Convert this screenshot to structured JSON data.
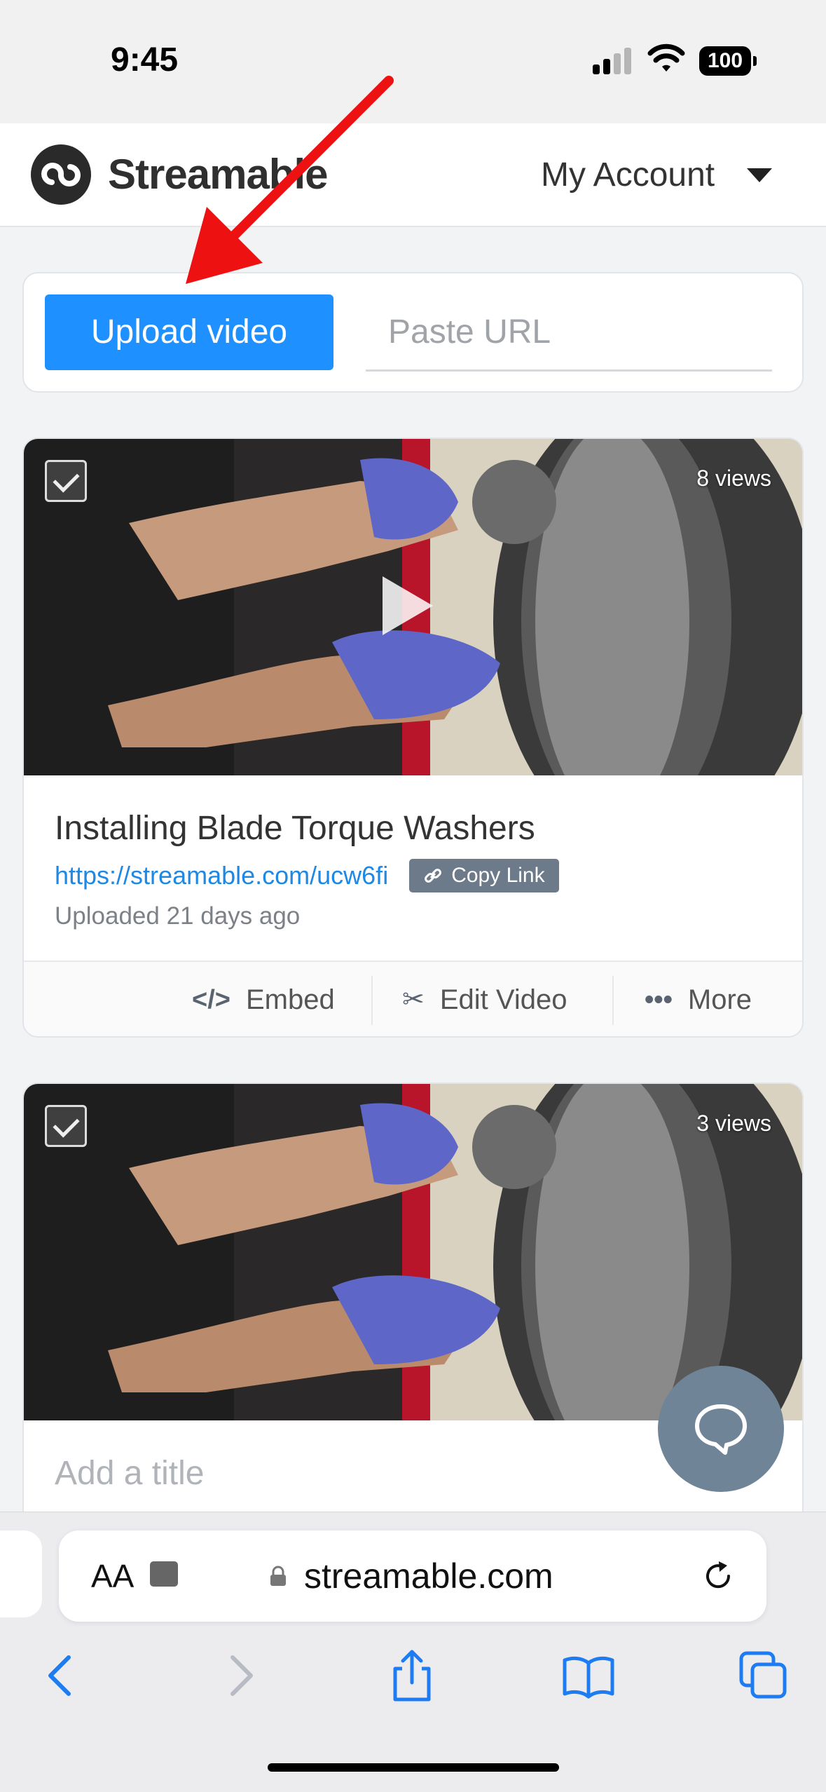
{
  "status_bar": {
    "time": "9:45",
    "battery": "100"
  },
  "header": {
    "logo_text": "Streamable",
    "account_label": "My Account"
  },
  "upload": {
    "button_label": "Upload video",
    "url_placeholder": "Paste URL"
  },
  "videos": [
    {
      "views": "8 views",
      "title": "Installing Blade Torque Washers",
      "link": "https://streamable.com/ucw6fi",
      "copy_label": "Copy Link",
      "uploaded": "Uploaded 21 days ago",
      "actions": {
        "embed": "Embed",
        "edit": "Edit Video",
        "more": "More"
      }
    },
    {
      "views": "3 views",
      "title": "Add a title"
    }
  ],
  "browser": {
    "aa_label": "AA",
    "domain": "streamable.com"
  },
  "colors": {
    "accent": "#1e90ff",
    "link": "#1e88e5",
    "chat": "#6f8497",
    "annotation": "#ee1111"
  }
}
